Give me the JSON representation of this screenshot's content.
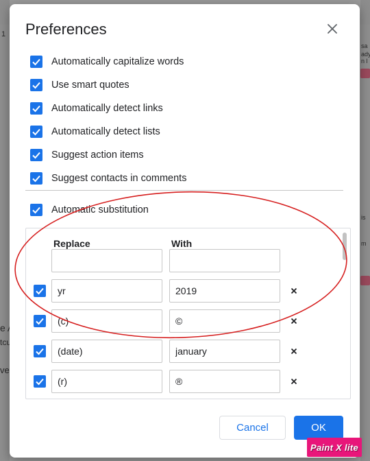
{
  "dialog": {
    "title": "Preferences"
  },
  "preferences": [
    {
      "label": "Automatically capitalize words",
      "checked": true
    },
    {
      "label": "Use smart quotes",
      "checked": true
    },
    {
      "label": "Automatically detect links",
      "checked": true
    },
    {
      "label": "Automatically detect lists",
      "checked": true
    },
    {
      "label": "Suggest action items",
      "checked": true
    },
    {
      "label": "Suggest contacts in comments",
      "checked": true
    }
  ],
  "substitution": {
    "label": "Automatic substitution",
    "checked": true,
    "columns": {
      "replace": "Replace",
      "with": "With"
    },
    "new_row": {
      "replace": "",
      "with": ""
    },
    "rows": [
      {
        "replace": "yr",
        "with": "2019",
        "checked": true
      },
      {
        "replace": "(c)",
        "with": "©",
        "checked": true
      },
      {
        "replace": "(date)",
        "with": "january",
        "checked": true
      },
      {
        "replace": "(r)",
        "with": "®",
        "checked": true
      }
    ],
    "delete_symbol": "×"
  },
  "buttons": {
    "cancel": "Cancel",
    "ok": "OK"
  },
  "background_fragments": [
    "1",
    "sa",
    "ady",
    "n l",
    "e A",
    "tcu",
    "ve",
    "m",
    "is"
  ],
  "watermark": {
    "text": "Paint X lite"
  },
  "colors": {
    "accent": "#1a73e8",
    "annotation": "#d61f1f",
    "watermark": "#e8167a"
  },
  "icons": {
    "close": "close-icon",
    "check": "check-icon",
    "delete": "delete-icon"
  }
}
